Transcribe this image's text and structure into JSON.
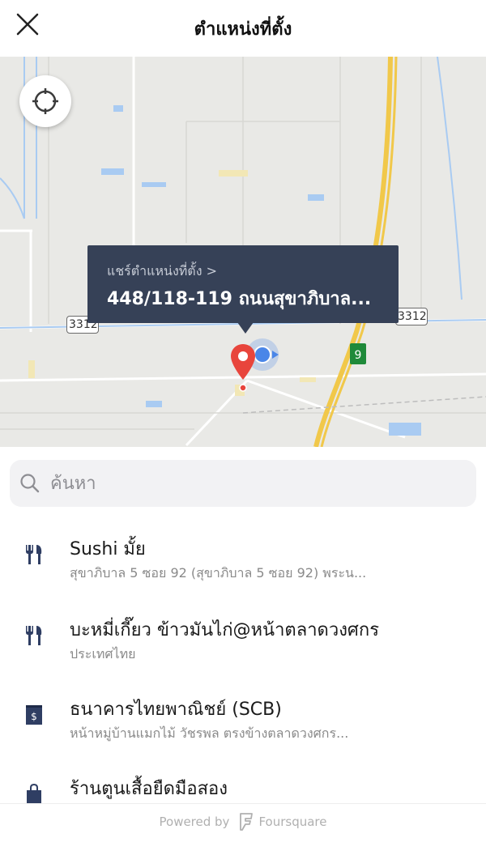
{
  "header": {
    "title": "ตำแหน่งที่ตั้ง"
  },
  "map": {
    "tooltip_label": "แชร์ตำแหน่งที่ตั้ง >",
    "tooltip_address": "448/118-119 ถนนสุขาภิบาล...",
    "road_labels": [
      "3312",
      "3312"
    ],
    "highway_label": "9"
  },
  "search": {
    "placeholder": "ค้นหา"
  },
  "places": [
    {
      "icon": "restaurant-icon",
      "name": "Sushi มั้ย",
      "address": "สุขาภิบาล 5 ซอย 92 (สุขาภิบาล 5 ซอย 92) พระน..."
    },
    {
      "icon": "restaurant-icon",
      "name": "บะหมี่เกี๊ยว ข้าวมันไก่@หน้าตลาดวงศกร",
      "address": "ประเทศไทย"
    },
    {
      "icon": "bank-icon",
      "name": "ธนาคารไทยพาณิชย์ (SCB)",
      "address": "หน้าหมู่บ้านแมกไม้ วัชรพล ตรงข้างตลาดวงศกร..."
    },
    {
      "icon": "shopping-bag-icon",
      "name": "ร้านตูนเสื้อยืดมือสอง",
      "address": ""
    }
  ],
  "footer": {
    "powered_by": "Powered by",
    "brand": "Foursquare"
  },
  "colors": {
    "tooltip_bg": "#364157",
    "pin": "#e8453c",
    "icon_navy": "#2f3e63",
    "highway": "#f1c84a"
  }
}
